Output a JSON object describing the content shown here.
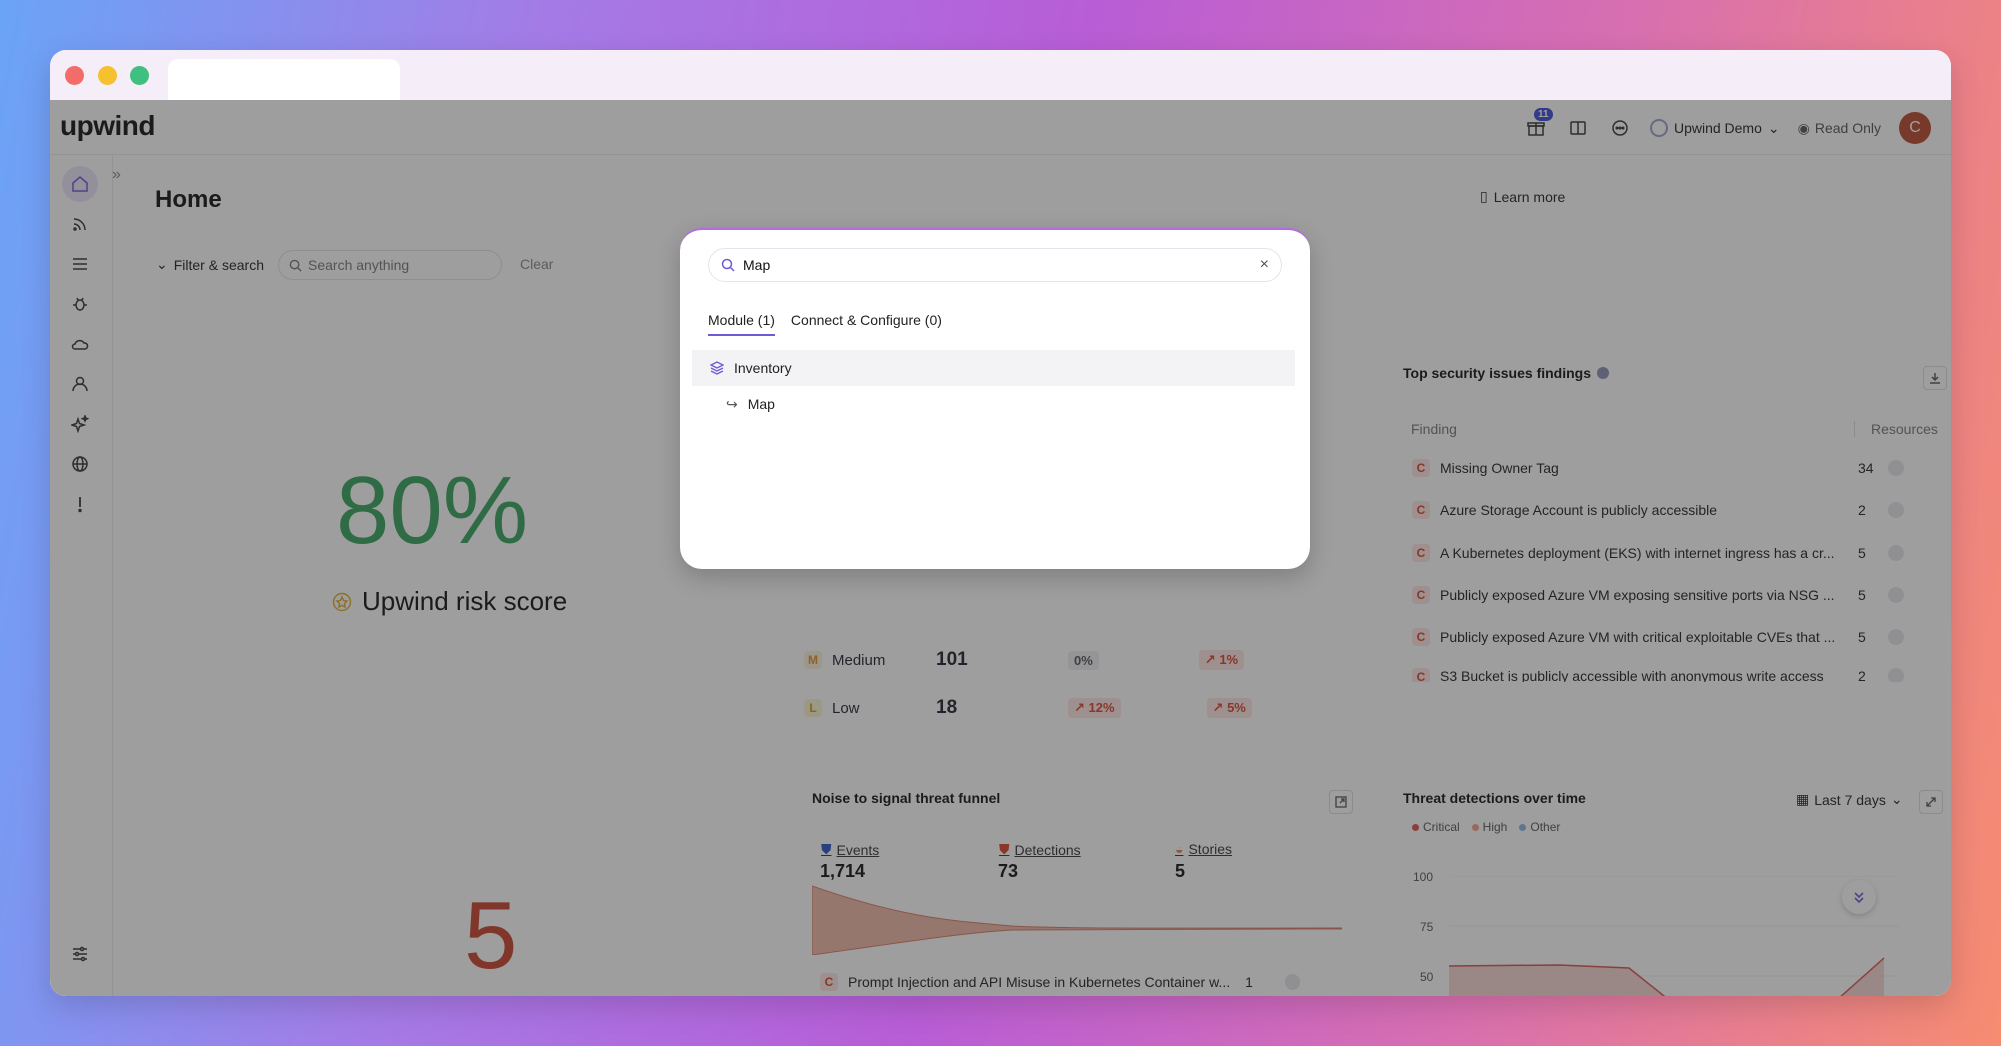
{
  "app": {
    "logo": "upwind"
  },
  "topbar": {
    "notifications_count": "11",
    "workspace": "Upwind Demo",
    "read_only": "Read Only",
    "avatar_initial": "C"
  },
  "sidebar": {
    "items": [
      "home-icon",
      "feed-icon",
      "list-icon",
      "bug-icon",
      "cloud-icon",
      "user-icon",
      "sparkles-icon",
      "globe-icon",
      "alert-icon"
    ],
    "bottom": "settings-icon"
  },
  "main": {
    "title": "Home",
    "learn_more": "Learn more",
    "filter_label": "Filter & search",
    "search_placeholder": "Search anything",
    "clear": "Clear"
  },
  "risk": {
    "score": "80%",
    "label": "Upwind risk score",
    "big_number": "5"
  },
  "severity": {
    "rows": [
      {
        "letter": "M",
        "name": "Medium",
        "count": "101",
        "pct1": "0%",
        "pct2": "1%"
      },
      {
        "letter": "L",
        "name": "Low",
        "count": "18",
        "pct1": "12%",
        "pct2": "5%"
      }
    ]
  },
  "findings": {
    "title": "Top security issues findings",
    "col_finding": "Finding",
    "col_resources": "Resources",
    "rows": [
      {
        "text": "Missing Owner Tag",
        "count": "34"
      },
      {
        "text": "Azure Storage Account is publicly accessible",
        "count": "2"
      },
      {
        "text": "A Kubernetes deployment (EKS) with internet ingress has a cr...",
        "count": "5"
      },
      {
        "text": "Publicly exposed Azure VM exposing sensitive ports via NSG ...",
        "count": "5"
      },
      {
        "text": "Publicly exposed Azure VM with critical exploitable CVEs that ...",
        "count": "5"
      },
      {
        "text": "S3 Bucket is publicly accessible with anonymous write access",
        "count": "2"
      }
    ],
    "badge_letter": "C"
  },
  "funnel": {
    "title": "Noise to signal threat funnel",
    "events_label": "Events",
    "events_value": "1,714",
    "detections_label": "Detections",
    "detections_value": "73",
    "stories_label": "Stories",
    "stories_value": "5",
    "story_row": {
      "text": "Prompt Injection and API Misuse in Kubernetes Container w...",
      "count": "1"
    }
  },
  "threats": {
    "title": "Threat detections over time",
    "range": "Last 7 days",
    "legend": [
      {
        "name": "Critical",
        "color": "#d9534f"
      },
      {
        "name": "High",
        "color": "#f0a088"
      },
      {
        "name": "Other",
        "color": "#8fb3e8"
      }
    ],
    "y_ticks": [
      "100",
      "75",
      "50"
    ]
  },
  "modal": {
    "query": "Map",
    "tabs": [
      "Module (1)",
      "Connect & Configure (0)"
    ],
    "results": [
      {
        "label": "Inventory",
        "icon": "layers-icon"
      },
      {
        "label": "Map",
        "icon": "arrow-return-icon"
      }
    ]
  },
  "colors": {
    "accent": "#6d5ad6",
    "critical": "#d7442c",
    "success": "#35a35d"
  }
}
